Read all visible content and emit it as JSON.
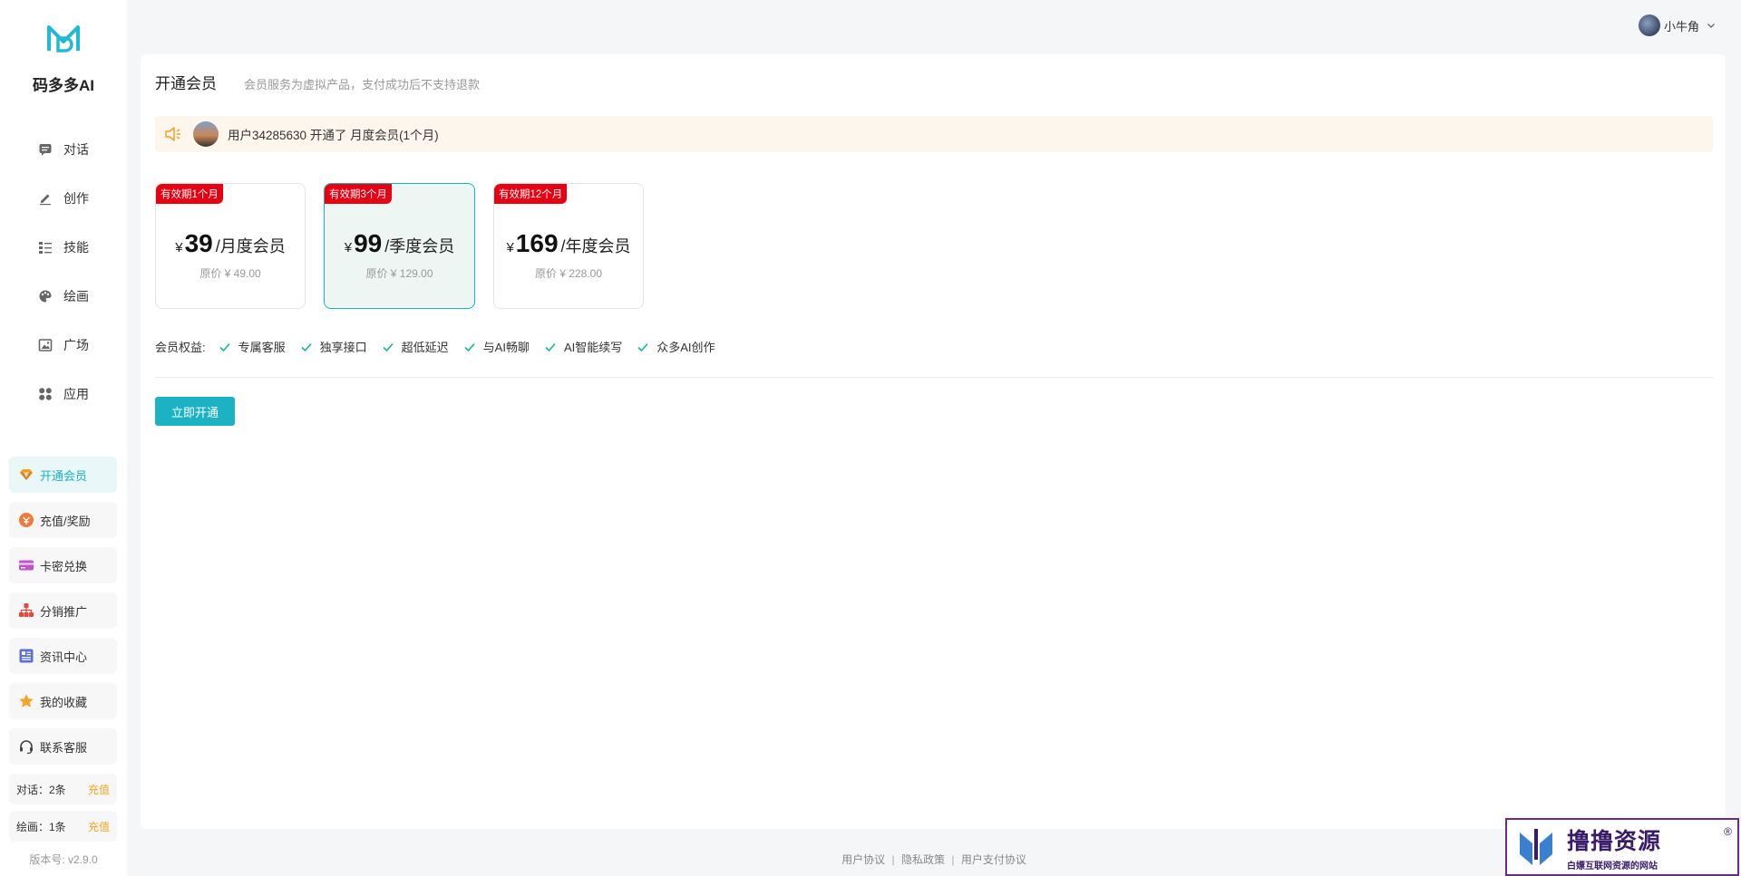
{
  "app": {
    "brand": "码多多AI",
    "version": "版本号: v2.9.0"
  },
  "nav": {
    "items": [
      {
        "label": "对话",
        "icon": "chat-icon"
      },
      {
        "label": "创作",
        "icon": "pen-icon"
      },
      {
        "label": "技能",
        "icon": "list-icon"
      },
      {
        "label": "绘画",
        "icon": "palette-icon"
      },
      {
        "label": "广场",
        "icon": "image-icon"
      },
      {
        "label": "应用",
        "icon": "apps-icon"
      }
    ]
  },
  "side_buttons": [
    {
      "label": "开通会员",
      "icon": "diamond-icon",
      "active": true
    },
    {
      "label": "充值/奖励",
      "icon": "coin-icon"
    },
    {
      "label": "卡密兑换",
      "icon": "card-icon"
    },
    {
      "label": "分销推广",
      "icon": "network-icon"
    },
    {
      "label": "资讯中心",
      "icon": "news-icon"
    },
    {
      "label": "我的收藏",
      "icon": "star-icon"
    },
    {
      "label": "联系客服",
      "icon": "headset-icon"
    }
  ],
  "quota": {
    "chat": {
      "label": "对话：2条",
      "action": "充值"
    },
    "draw": {
      "label": "绘画：1条",
      "action": "充值"
    }
  },
  "header": {
    "username": "小牛角"
  },
  "page": {
    "title": "开通会员",
    "subtitle": "会员服务为虚拟产品，支付成功后不支持退款",
    "notice": "用户34285630 开通了 月度会员(1个月)"
  },
  "plans": [
    {
      "tag": "有效期1个月",
      "currency": "¥",
      "price": "39",
      "name": "/月度会员",
      "original": "原价 ¥ 49.00",
      "selected": false
    },
    {
      "tag": "有效期3个月",
      "currency": "¥",
      "price": "99",
      "name": "/季度会员",
      "original": "原价 ¥ 129.00",
      "selected": true
    },
    {
      "tag": "有效期12个月",
      "currency": "¥",
      "price": "169",
      "name": "/年度会员",
      "original": "原价 ¥ 228.00",
      "selected": false
    }
  ],
  "benefits": {
    "label": "会员权益:",
    "items": [
      "专属客服",
      "独享接口",
      "超低延迟",
      "与AI畅聊",
      "AI智能续写",
      "众多AI创作"
    ]
  },
  "buy_button": "立即开通",
  "footer": {
    "links": [
      "用户协议",
      "隐私政策",
      "用户支付协议"
    ],
    "separator": "|"
  },
  "watermark": {
    "title": "撸撸资源",
    "subtitle": "白嫖互联网资源的网站",
    "mark": "®"
  },
  "colors": {
    "accent": "#1bb3c3",
    "tag_red": "#e60012",
    "notice_bg": "#fdf6ec",
    "charge": "#f5a623"
  }
}
